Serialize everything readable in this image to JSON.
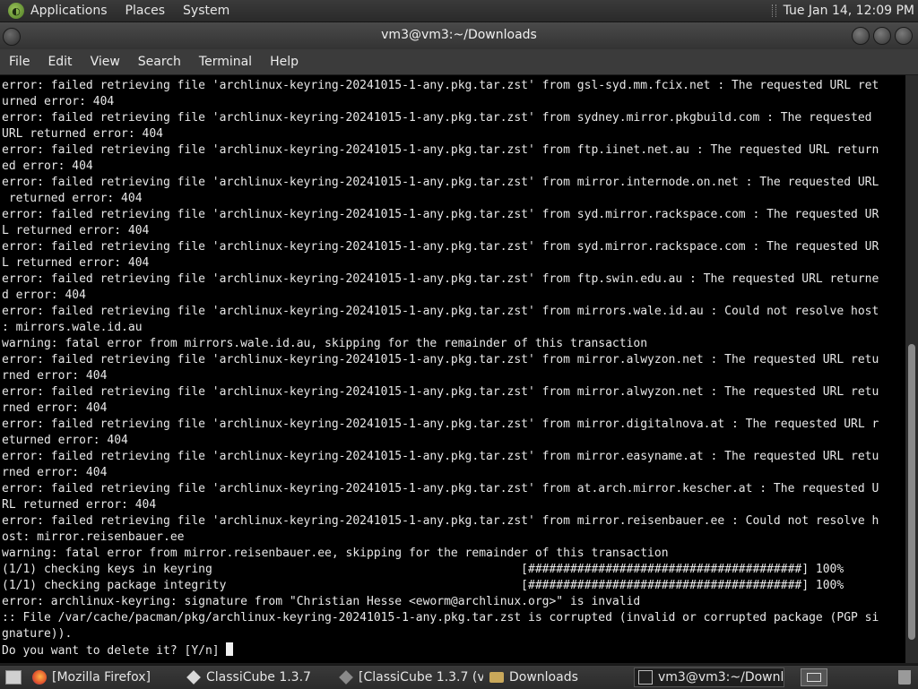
{
  "top_panel": {
    "menus": [
      "Applications",
      "Places",
      "System"
    ],
    "clock": "Tue Jan 14, 12:09 PM"
  },
  "window": {
    "title": "vm3@vm3:~/Downloads"
  },
  "menubar": {
    "items": [
      "File",
      "Edit",
      "View",
      "Search",
      "Terminal",
      "Help"
    ]
  },
  "terminal": {
    "lines": [
      "error: failed retrieving file 'archlinux-keyring-20241015-1-any.pkg.tar.zst' from gsl-syd.mm.fcix.net : The requested URL ret",
      "urned error: 404",
      "error: failed retrieving file 'archlinux-keyring-20241015-1-any.pkg.tar.zst' from sydney.mirror.pkgbuild.com : The requested",
      "URL returned error: 404",
      "error: failed retrieving file 'archlinux-keyring-20241015-1-any.pkg.tar.zst' from ftp.iinet.net.au : The requested URL return",
      "ed error: 404",
      "error: failed retrieving file 'archlinux-keyring-20241015-1-any.pkg.tar.zst' from mirror.internode.on.net : The requested URL",
      " returned error: 404",
      "error: failed retrieving file 'archlinux-keyring-20241015-1-any.pkg.tar.zst' from syd.mirror.rackspace.com : The requested UR",
      "L returned error: 404",
      "error: failed retrieving file 'archlinux-keyring-20241015-1-any.pkg.tar.zst' from syd.mirror.rackspace.com : The requested UR",
      "L returned error: 404",
      "error: failed retrieving file 'archlinux-keyring-20241015-1-any.pkg.tar.zst' from ftp.swin.edu.au : The requested URL returne",
      "d error: 404",
      "error: failed retrieving file 'archlinux-keyring-20241015-1-any.pkg.tar.zst' from mirrors.wale.id.au : Could not resolve host",
      ": mirrors.wale.id.au",
      "warning: fatal error from mirrors.wale.id.au, skipping for the remainder of this transaction",
      "error: failed retrieving file 'archlinux-keyring-20241015-1-any.pkg.tar.zst' from mirror.alwyzon.net : The requested URL retu",
      "rned error: 404",
      "error: failed retrieving file 'archlinux-keyring-20241015-1-any.pkg.tar.zst' from mirror.alwyzon.net : The requested URL retu",
      "rned error: 404",
      "error: failed retrieving file 'archlinux-keyring-20241015-1-any.pkg.tar.zst' from mirror.digitalnova.at : The requested URL r",
      "eturned error: 404",
      "error: failed retrieving file 'archlinux-keyring-20241015-1-any.pkg.tar.zst' from mirror.easyname.at : The requested URL retu",
      "rned error: 404",
      "error: failed retrieving file 'archlinux-keyring-20241015-1-any.pkg.tar.zst' from at.arch.mirror.kescher.at : The requested U",
      "RL returned error: 404",
      "error: failed retrieving file 'archlinux-keyring-20241015-1-any.pkg.tar.zst' from mirror.reisenbauer.ee : Could not resolve h",
      "ost: mirror.reisenbauer.ee",
      "warning: fatal error from mirror.reisenbauer.ee, skipping for the remainder of this transaction",
      "(1/1) checking keys in keyring                                            [#######################################] 100%",
      "(1/1) checking package integrity                                          [#######################################] 100%",
      "error: archlinux-keyring: signature from \"Christian Hesse <eworm@archlinux.org>\" is invalid",
      ":: File /var/cache/pacman/pkg/archlinux-keyring-20241015-1-any.pkg.tar.zst is corrupted (invalid or corrupted package (PGP si",
      "gnature)).",
      "Do you want to delete it? [Y/n] "
    ],
    "scroll_position": 0.92
  },
  "taskbar": {
    "tasks": [
      {
        "label": "[Mozilla Firefox]",
        "icon": "firefox-icon"
      },
      {
        "label": "ClassiCube 1.3.7",
        "icon": "classicube-icon"
      },
      {
        "label": "[ClassiCube 1.3.7 (v...",
        "icon": "classicube-icon"
      },
      {
        "label": "Downloads",
        "icon": "folder-icon"
      },
      {
        "label": "vm3@vm3:~/Downl...",
        "icon": "terminal-icon"
      }
    ]
  }
}
